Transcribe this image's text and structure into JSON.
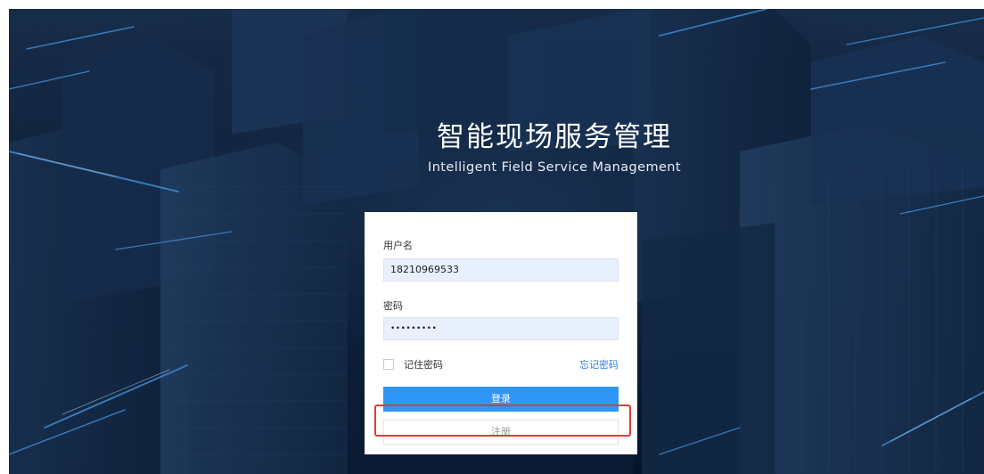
{
  "app": {
    "title_cn": "智能现场服务管理",
    "title_en": "Intelligent Field Service Management"
  },
  "login": {
    "username_label": "用户名",
    "username_value": "18210969533",
    "password_label": "密码",
    "password_value": "•••••••••",
    "remember_label": "记住密码",
    "remember_checked": false,
    "forgot_label": "忘记密码",
    "login_label": "登录",
    "register_label": "注册"
  },
  "colors": {
    "primary": "#2f96f7",
    "link": "#2f7fe0",
    "input_bg": "#e8f0fe",
    "highlight": "#e23b32",
    "background": "#0a1a33"
  }
}
